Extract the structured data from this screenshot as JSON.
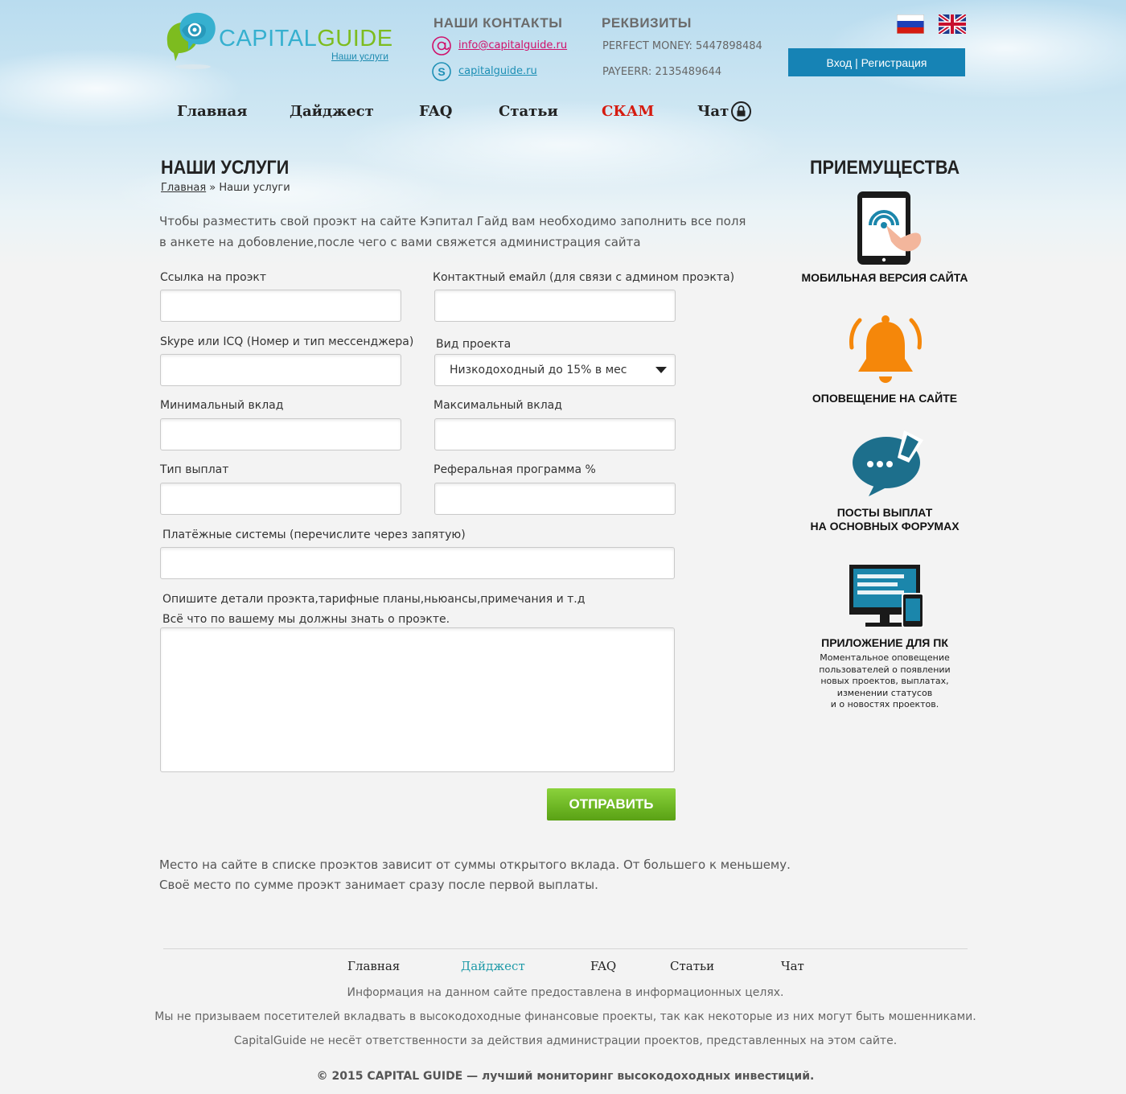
{
  "brand": {
    "name_part1": "CAPITAL",
    "name_part2": "GUIDE",
    "sublink": "Наши услуги"
  },
  "contacts": {
    "title": "НАШИ КОНТАКТЫ",
    "email": "info@capitalguide.ru",
    "skype": "capitalguide.ru"
  },
  "requisites": {
    "title": "РЕКВИЗИТЫ",
    "perfect_money": "PERFECT MONEY: 5447898484",
    "payeer": "PAYEERR: 2135489644"
  },
  "auth": {
    "login_label": "Вход | Регистрация"
  },
  "nav": {
    "home": "Главная",
    "digest": "Дайджест",
    "faq": "FAQ",
    "articles": "Статьи",
    "scam": "СКАМ",
    "chat": "Чат"
  },
  "page": {
    "title": "НАШИ УСЛУГИ",
    "breadcrumb_home": "Главная",
    "breadcrumb_sep": " » ",
    "breadcrumb_current": "Наши услуги",
    "intro_line1": "Чтобы разместить свой проэкт на сайте Кэпитал Гайд вам необходимо заполнить все поля",
    "intro_line2": "в анкете на добовление,после чего с вами свяжется администрация сайта"
  },
  "form": {
    "project_link_label": "Ссылка на проэкт",
    "project_link_value": "",
    "contact_email_label": "Контактный емайл (для связи с админом проэкта)",
    "contact_email_value": "",
    "messenger_label": "Skype или ICQ (Номер и тип мессенджера)",
    "messenger_value": "",
    "project_type_label": "Вид проекта",
    "project_type_selected": "Низкодоходный до 15% в мес",
    "min_deposit_label": "Минимальный вклад",
    "min_deposit_value": "",
    "max_deposit_label": "Максимальный вклад",
    "max_deposit_value": "",
    "payout_type_label": "Тип выплат",
    "payout_type_value": "",
    "referral_label": "Реферальная программа %",
    "referral_value": "",
    "payment_systems_label": "Платёжные системы (перечислите через запятую)",
    "payment_systems_value": "",
    "details_label_line1": "Опишите детали проэкта,тарифные планы,ньюансы,примечания и т.д",
    "details_label_line2": "Всё что по вашему мы должны знать о проэкте.",
    "details_value": "",
    "submit_label": "ОТПРАВИТЬ"
  },
  "note": {
    "line1": "Место на сайте в списке проэктов зависит от суммы открытого вклада. От большего к меньшему.",
    "line2": "Своё место по сумме проэкт занимает сразу после первой выплаты."
  },
  "advantages": {
    "title": "ПРИЕМУЩЕСТВА",
    "mobile": "МОБИЛЬНАЯ ВЕРСИЯ САЙТА",
    "notify": "ОПОВЕЩЕНИЕ НА САЙТЕ",
    "posts_line1": "ПОСТЫ ВЫПЛАТ",
    "posts_line2": "НА ОСНОВНЫХ ФОРУМАХ",
    "pc_app": "ПРИЛОЖЕНИЕ ДЛЯ ПК",
    "pc_desc_1": "Моментальное оповещение",
    "pc_desc_2": "пользователей о появлении",
    "pc_desc_3": "новых проектов, выплатах,",
    "pc_desc_4": "изменении статусов",
    "pc_desc_5": "и о новостях проектов."
  },
  "footer": {
    "nav_home": "Главная",
    "nav_digest": "Дайджест",
    "nav_faq": "FAQ",
    "nav_articles": "Статьи",
    "nav_chat": "Чат",
    "info1": "Информация на данном сайте предоставлена в информационных целях.",
    "info2": "Мы не призываем посетителей вкладвать в высокодоходные финансовые проекты, так как некоторые из них могут быть мошенниками.",
    "info3": "CapitalGuide не несёт ответственности за действия администрации проектов, представленных на этом сайте.",
    "copyright": "© 2015 CAPITAL GUIDE — лучший мониторинг высокодоходных инвестиций."
  },
  "icons": {
    "email": "at-sign-icon",
    "skype": "skype-icon",
    "lock": "lock-icon",
    "tablet": "tablet-touch-icon",
    "bell": "bell-icon",
    "chat": "chat-bubble-icon",
    "pc": "monitor-phone-icon"
  },
  "colors": {
    "accent_blue": "#1683b5",
    "scam_red": "#d51b10",
    "submit_green": "#6cb523",
    "bell_orange": "#f5870a",
    "icon_teal": "#1d6f8c"
  }
}
